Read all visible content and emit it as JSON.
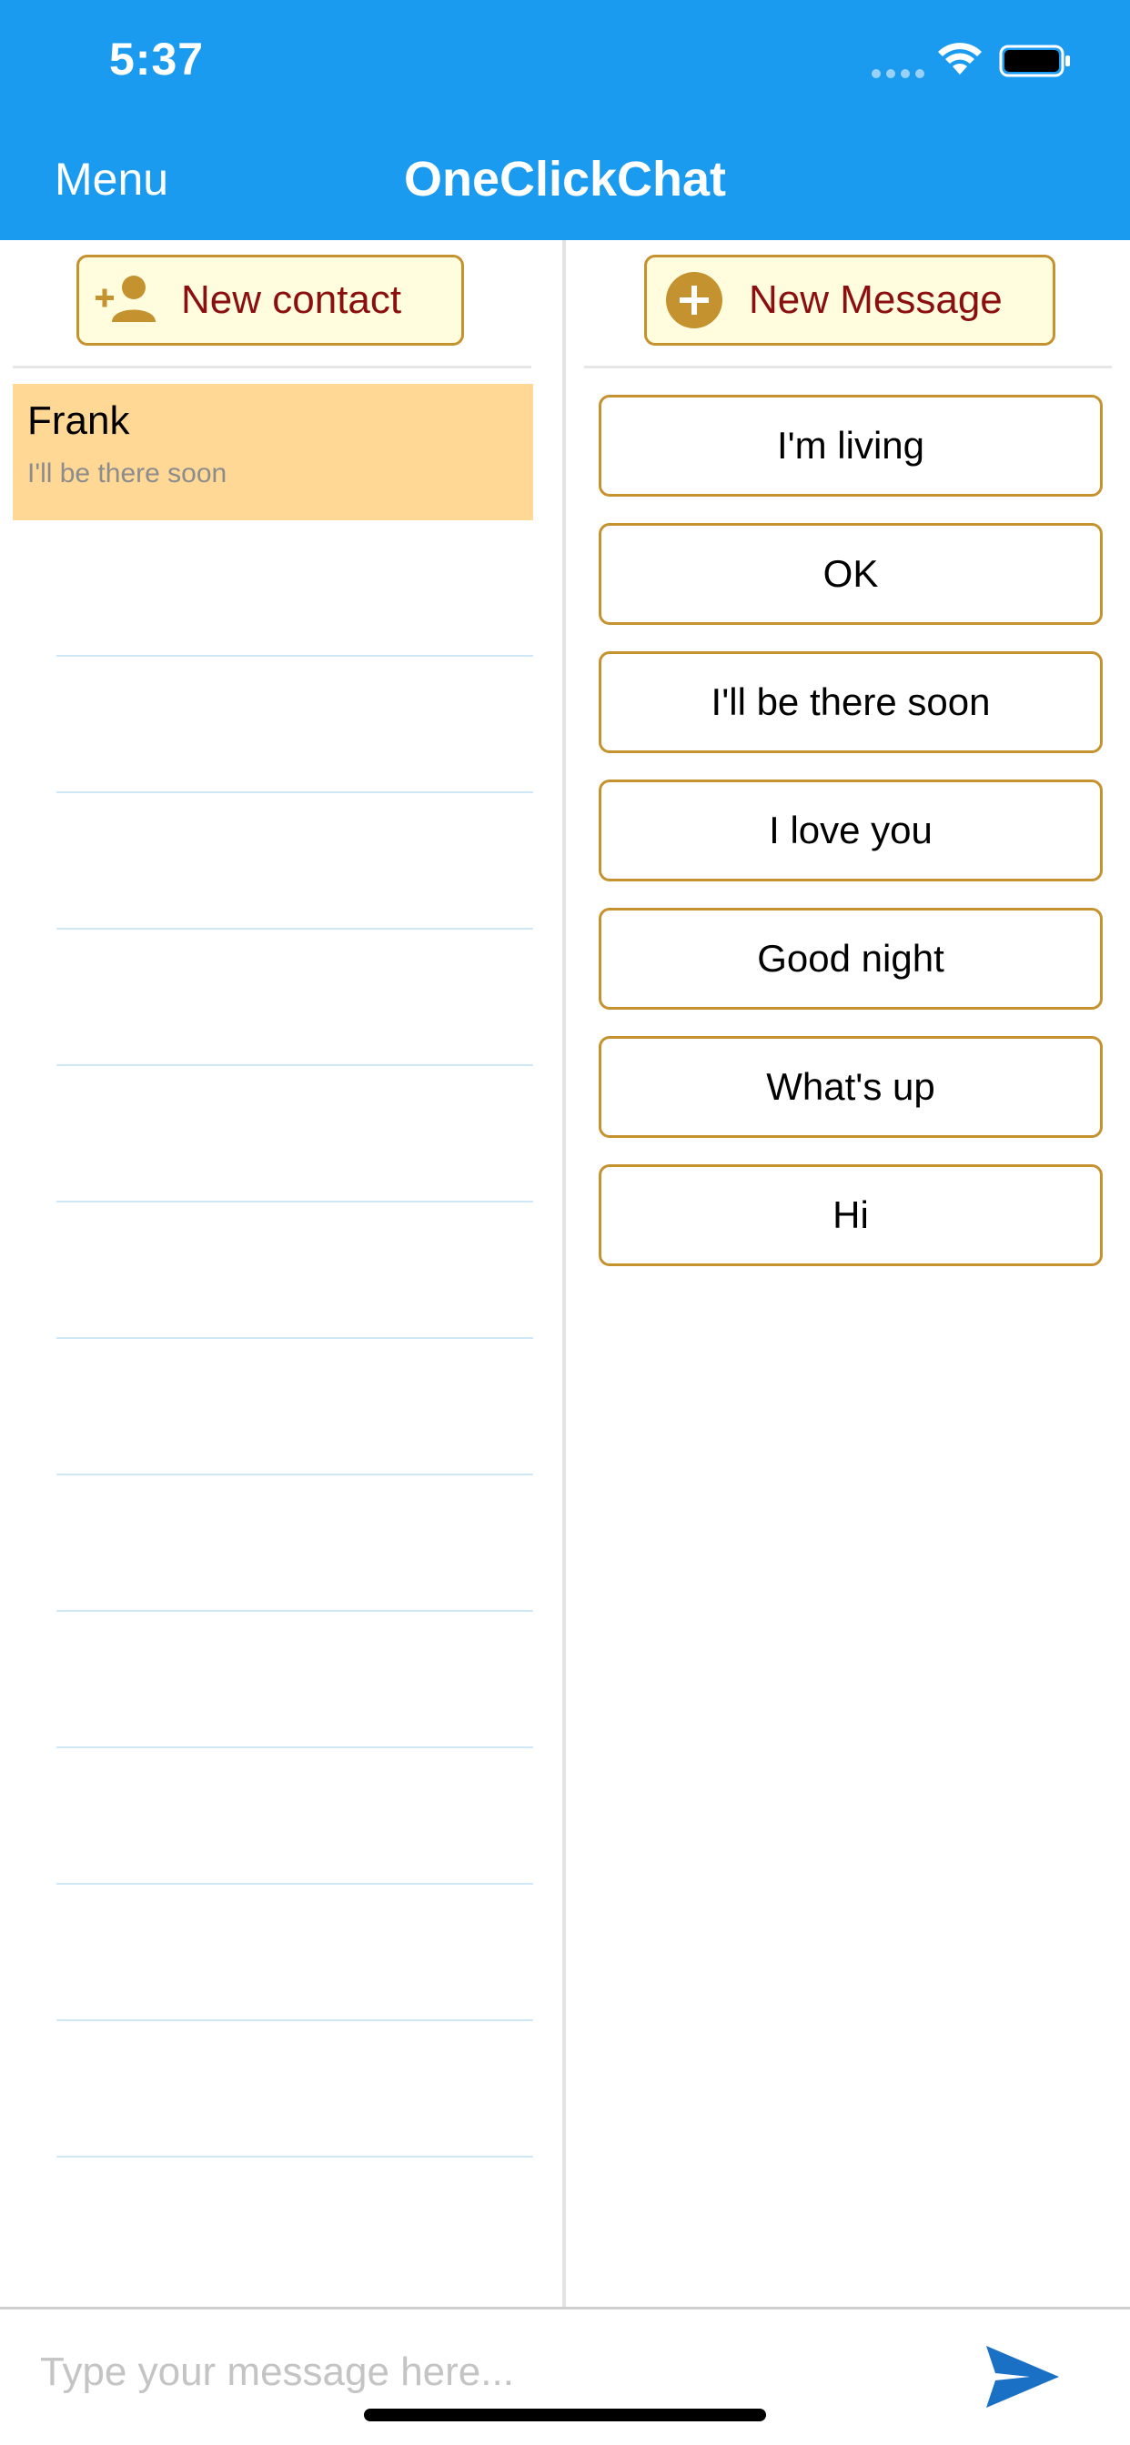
{
  "status_bar": {
    "time": "5:37"
  },
  "header": {
    "menu_label": "Menu",
    "title": "OneClickChat",
    "color": "#1B9BF0"
  },
  "contacts_panel": {
    "new_contact_label": "New contact",
    "new_contact_icon": "add-person-icon",
    "contacts": [
      {
        "name": "Frank",
        "last_message": "I'll be there soon",
        "selected": true
      }
    ]
  },
  "messages_panel": {
    "new_message_label": "New Message",
    "new_message_icon": "plus-circle-icon",
    "messages": [
      "I'm living",
      "OK",
      "I'll be there soon",
      "I love you",
      "Good night",
      "What's up",
      "Hi"
    ]
  },
  "composer": {
    "placeholder": "Type your message here...",
    "value": "",
    "send_icon": "send-icon"
  },
  "colors": {
    "accent_gold": "#C4922E",
    "button_fill": "#FFFDDD",
    "button_text": "#8B0F0F",
    "selected_row": "#FFD896",
    "send_blue": "#1A70C4"
  }
}
